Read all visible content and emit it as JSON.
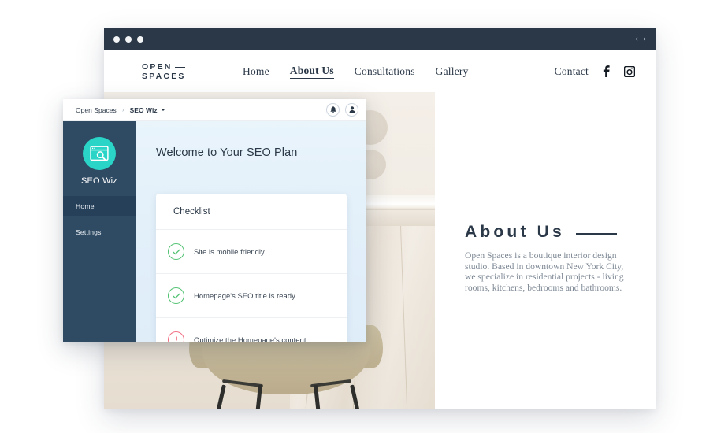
{
  "browser": {
    "traffic_lights": [
      "close",
      "minimize",
      "maximize"
    ],
    "nav_back": "‹",
    "nav_forward": "›"
  },
  "site": {
    "logo": {
      "line1": "OPEN",
      "line2": "SPACES"
    },
    "nav": [
      {
        "label": "Home",
        "active": false
      },
      {
        "label": "About Us",
        "active": true
      },
      {
        "label": "Consultations",
        "active": false
      },
      {
        "label": "Gallery",
        "active": false
      }
    ],
    "nav_right": {
      "contact": "Contact",
      "facebook": "f",
      "instagram": "instagram-icon"
    },
    "about": {
      "title": "About Us",
      "body": "Open Spaces is a boutique interior design studio. Based in downtown New York City, we specialize in residential projects - living rooms, kitchens, bedrooms and bathrooms."
    }
  },
  "seo_panel": {
    "breadcrumb": {
      "root": "Open Spaces",
      "separator": "›",
      "current": "SEO Wiz"
    },
    "actions": {
      "notifications": "bell-icon",
      "account": "user-icon"
    },
    "sidebar": {
      "app_name": "SEO Wiz",
      "items": [
        {
          "label": "Home",
          "active": true
        },
        {
          "label": "Settings",
          "active": false
        }
      ]
    },
    "main": {
      "heading": "Welcome to Your SEO Plan",
      "card_title": "Checklist",
      "checklist": [
        {
          "label": "Site is mobile friendly",
          "status": "done"
        },
        {
          "label": "Homepage's SEO title is ready",
          "status": "done"
        },
        {
          "label": "Optimize the Homepage's content",
          "status": "todo"
        }
      ]
    }
  },
  "colors": {
    "titlebar": "#2b3847",
    "sidebar": "#2f4a63",
    "sidebar_active": "#27405a",
    "accent_teal": "#2ad4c6",
    "status_done": "#4ec16f",
    "status_todo": "#f2697f",
    "panel_bg": "#e6f2fb",
    "ink": "#2b3847"
  }
}
